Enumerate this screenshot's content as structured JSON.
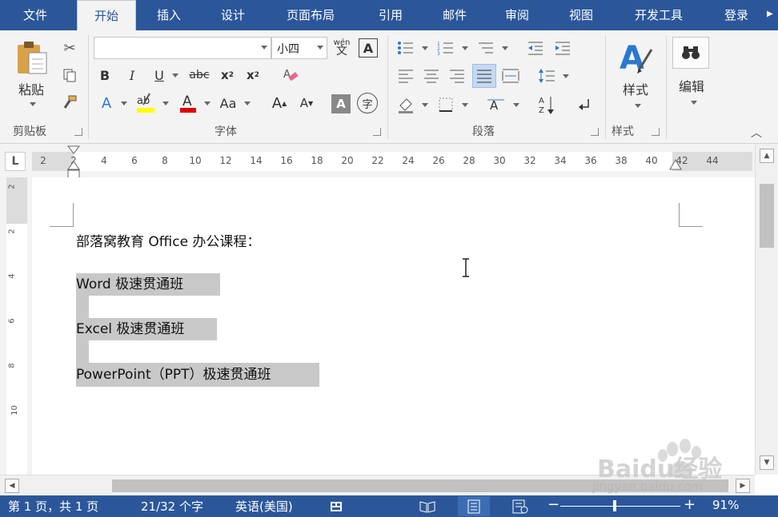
{
  "tabs": {
    "file": "文件",
    "home": "开始",
    "insert": "插入",
    "design": "设计",
    "layout": "页面布局",
    "references": "引用",
    "mailings": "邮件",
    "review": "审阅",
    "view": "视图",
    "developer": "开发工具",
    "login": "登录"
  },
  "ribbon": {
    "clipboard": {
      "paste_label": "粘贴",
      "group_label": "剪贴板"
    },
    "font": {
      "font_name": "",
      "font_size": "小四",
      "group_label": "字体",
      "wen_label": "wén",
      "wen_char": "文",
      "aa_label": "Aa"
    },
    "paragraph": {
      "group_label": "段落"
    },
    "styles": {
      "button_label": "样式",
      "group_label": "样式"
    },
    "editing": {
      "button_label": "编辑"
    }
  },
  "ruler": {
    "corner": "L",
    "ticks": [
      "2",
      "2",
      "4",
      "6",
      "8",
      "10",
      "12",
      "14",
      "16",
      "18",
      "20",
      "22",
      "24",
      "26",
      "28",
      "30",
      "32",
      "34",
      "36",
      "38",
      "40",
      "42",
      "44"
    ],
    "vticks": [
      "2",
      "2",
      "4",
      "6",
      "8",
      "10"
    ]
  },
  "document": {
    "line1": "部落窝教育 Office 办公课程：",
    "line2": "Word 极速贯通班",
    "line3": "Excel 极速贯通班",
    "line4": "PowerPoint（PPT）极速贯通班"
  },
  "status": {
    "page": "第 1 页，共 1 页",
    "words": "21/32 个字",
    "language": "英语(美国)",
    "zoom": "91%"
  },
  "watermark": {
    "brand": "Baidu经验",
    "url": "jingyan.baidu.com"
  },
  "colors": {
    "accent": "#2b579a",
    "selection": "#c8c8c8",
    "ribbon_bg": "#f3f3f3"
  }
}
